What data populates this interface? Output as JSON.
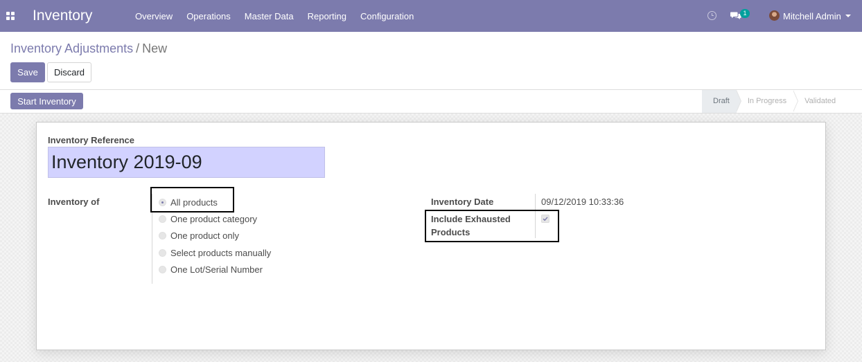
{
  "navbar": {
    "app_title": "Inventory",
    "menu": [
      "Overview",
      "Operations",
      "Master Data",
      "Reporting",
      "Configuration"
    ],
    "chat_badge": "1",
    "user_name": "Mitchell Admin",
    "bg_color": "#7c7bad",
    "icons": {
      "apps": "apps-grid-icon",
      "activity": "clock-icon",
      "messages": "chat-icon",
      "user_menu": "caret-down-icon"
    }
  },
  "breadcrumb": {
    "parent": "Inventory Adjustments",
    "separator": "/",
    "current": "New"
  },
  "buttons": {
    "save": "Save",
    "discard": "Discard",
    "start": "Start Inventory"
  },
  "statusbar": {
    "stages": [
      "Draft",
      "In Progress",
      "Validated"
    ],
    "current": "Draft"
  },
  "form": {
    "reference_label": "Inventory Reference",
    "reference_value": "Inventory 2019-09",
    "inventory_of_label": "Inventory of",
    "inventory_of_options": [
      "All products",
      "One product category",
      "One product only",
      "Select products manually",
      "One Lot/Serial Number"
    ],
    "inventory_of_selected": "All products",
    "date_label": "Inventory Date",
    "date_value": "09/12/2019 10:33:36",
    "exhausted_label": "Include Exhausted Products",
    "exhausted_checked": true
  }
}
